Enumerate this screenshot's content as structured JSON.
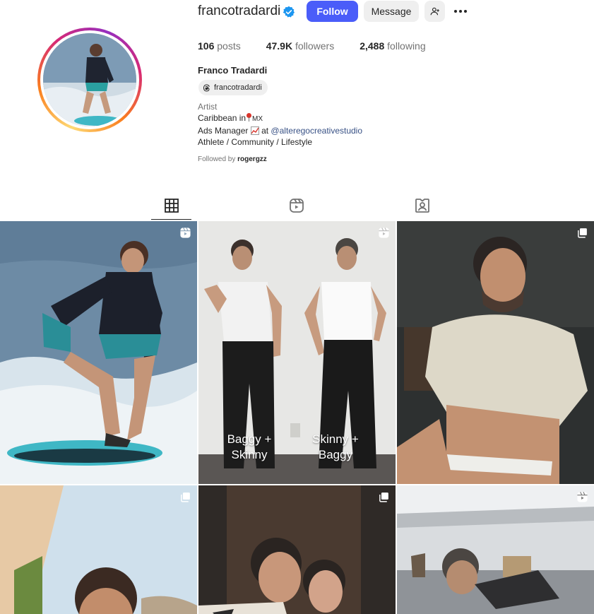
{
  "profile": {
    "username": "francotradardi",
    "follow_label": "Follow",
    "message_label": "Message",
    "full_name": "Franco Tradardi",
    "threads_handle": "francotradardi",
    "stats": {
      "posts_count": "106",
      "posts_label": "posts",
      "followers_count": "47.9K",
      "followers_label": "followers",
      "following_count": "2,488",
      "following_label": "following"
    },
    "bio": {
      "category": "Artist",
      "line1_prefix": "Caribbean in",
      "line1_suffix": "MX",
      "line2_prefix": "Ads Manager",
      "line2_mid": "at",
      "line2_link": "@alteregocreativestudio",
      "line3": "Athlete / Community / Lifestyle"
    },
    "followed_by_prefix": "Followed by",
    "followed_by_user": "rogergzz"
  },
  "tabs": [
    {
      "name": "posts",
      "icon": "grid-icon",
      "active": true
    },
    {
      "name": "reels",
      "icon": "reels-icon",
      "active": false
    },
    {
      "name": "tagged",
      "icon": "tagged-icon",
      "active": false
    }
  ],
  "posts": [
    {
      "type": "reel",
      "icon": "reels-icon"
    },
    {
      "type": "reel",
      "icon": "reels-icon",
      "caption_left": "Baggy + Skinny",
      "caption_right": "Skinny + Baggy"
    },
    {
      "type": "carousel",
      "icon": "carousel-icon"
    },
    {
      "type": "carousel",
      "icon": "carousel-icon"
    },
    {
      "type": "carousel",
      "icon": "carousel-icon"
    },
    {
      "type": "reel",
      "icon": "reels-icon"
    }
  ],
  "colors": {
    "follow_button": "#4a5df9",
    "secondary_button": "#efefef",
    "link": "#385185",
    "verified": "#1c96f0"
  }
}
